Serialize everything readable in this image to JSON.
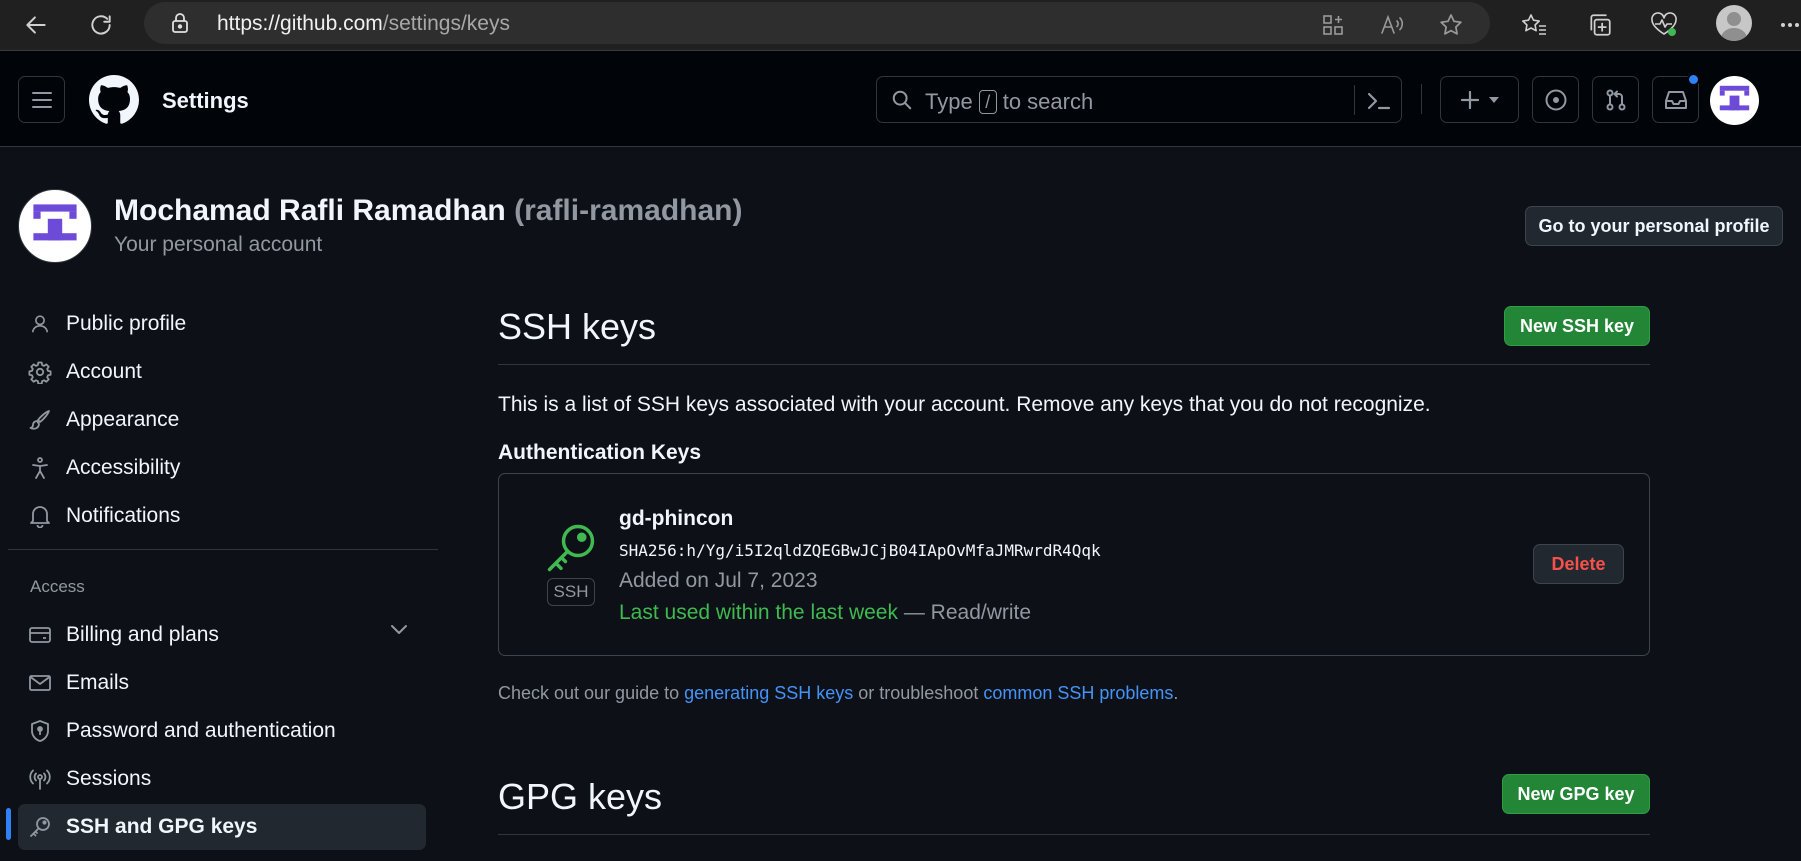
{
  "browser": {
    "url_host": "https://github.com",
    "url_path": "/settings/keys"
  },
  "header": {
    "title": "Settings",
    "search": {
      "prefix": "Type",
      "key": "/",
      "suffix": "to search"
    }
  },
  "account": {
    "name": "Mochamad Rafli Ramadhan",
    "handle": "(rafli-ramadhan)",
    "subtitle": "Your personal account",
    "profile_button": "Go to your personal profile"
  },
  "sidebar": {
    "items": [
      {
        "label": "Public profile",
        "icon": "person-icon"
      },
      {
        "label": "Account",
        "icon": "gear-icon"
      },
      {
        "label": "Appearance",
        "icon": "paintbrush-icon"
      },
      {
        "label": "Accessibility",
        "icon": "accessibility-icon"
      },
      {
        "label": "Notifications",
        "icon": "bell-icon"
      }
    ],
    "access_heading": "Access",
    "access_items": [
      {
        "label": "Billing and plans",
        "icon": "credit-card-icon"
      },
      {
        "label": "Emails",
        "icon": "mail-icon"
      },
      {
        "label": "Password and authentication",
        "icon": "shield-lock-icon"
      },
      {
        "label": "Sessions",
        "icon": "broadcast-icon"
      },
      {
        "label": "SSH and GPG keys",
        "icon": "key-icon",
        "active": true
      }
    ]
  },
  "ssh": {
    "title": "SSH keys",
    "new_button": "New SSH key",
    "intro": "This is a list of SSH keys associated with your account. Remove any keys that you do not recognize.",
    "auth_heading": "Authentication Keys",
    "key": {
      "badge": "SSH",
      "name": "gd-phincon",
      "fingerprint": "SHA256:h/Yg/i5I2qldZQEGBwJCjB04IApOvMfaJMRwrdR4Qqk",
      "added": "Added on Jul 7, 2023",
      "last_used": "Last used within the last week",
      "access": "— Read/write",
      "delete_label": "Delete"
    },
    "guide": {
      "prefix": "Check out our guide to",
      "link1": "generating SSH keys",
      "middle": "or troubleshoot",
      "link2": "common SSH problems",
      "suffix": "."
    }
  },
  "gpg": {
    "title": "GPG keys",
    "new_button": "New GPG key"
  },
  "colors": {
    "background": "#0d1117",
    "accent_green": "#238636",
    "link_blue": "#4493f8",
    "danger_red": "#f85149"
  }
}
